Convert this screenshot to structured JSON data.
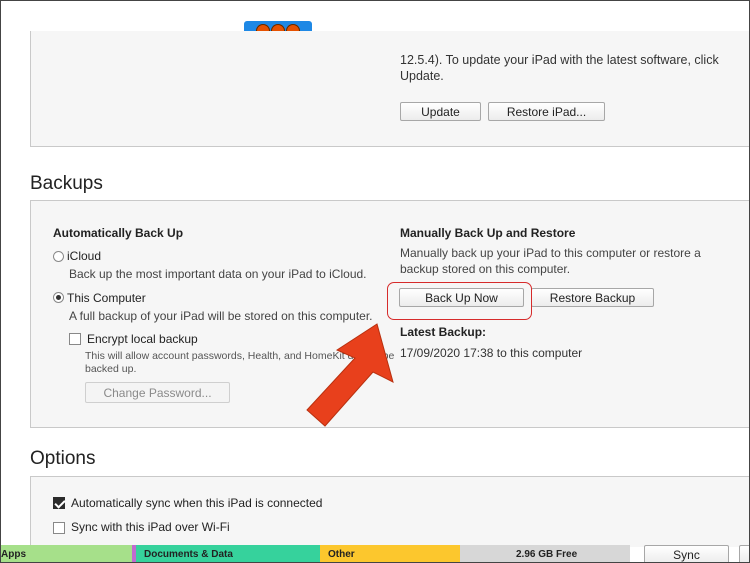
{
  "top_section": {
    "description_line1": "12.5.4). To update your iPad with the latest software, click",
    "description_line2": "Update.",
    "update_button": "Update",
    "restore_button": "Restore iPad..."
  },
  "backups": {
    "heading": "Backups",
    "auto": {
      "title": "Automatically Back Up",
      "icloud_label": "iCloud",
      "icloud_desc": "Back up the most important data on your iPad to iCloud.",
      "computer_label": "This Computer",
      "computer_desc": "A full backup of your iPad will be stored on this computer.",
      "encrypt_label": "Encrypt local backup",
      "encrypt_desc_line1": "This will allow account passwords, Health, and HomeKit data to be",
      "encrypt_desc_line2": "backed up.",
      "change_password_button": "Change Password..."
    },
    "manual": {
      "title": "Manually Back Up and Restore",
      "desc_line1": "Manually back up your iPad to this computer or restore a",
      "desc_line2": "backup stored on this computer.",
      "back_up_now_button": "Back Up Now",
      "restore_backup_button": "Restore Backup",
      "latest_title": "Latest Backup:",
      "latest_value": "17/09/2020 17:38 to this computer"
    }
  },
  "options": {
    "heading": "Options",
    "auto_sync_label": "Automatically sync when this iPad is connected",
    "wifi_sync_label": "Sync with this iPad over Wi-Fi"
  },
  "storage_bar": {
    "segments": [
      {
        "label": "Apps",
        "color": "#a6e08a"
      },
      {
        "label": "Documents & Data",
        "color": "#36d29c"
      },
      {
        "label": "Other",
        "color": "#fcc72d"
      },
      {
        "label": "2.96 GB Free",
        "color": "#d7d7d7"
      }
    ],
    "sync_button": "Sync"
  },
  "colors": {
    "highlight": "#d62b2b",
    "arrow": "#e8401c",
    "badge": "#1e88e5"
  }
}
